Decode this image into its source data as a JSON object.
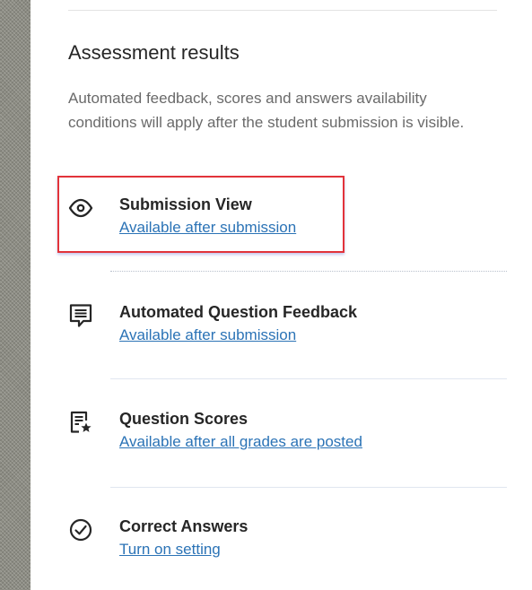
{
  "section": {
    "title": "Assessment results",
    "description": "Automated feedback, scores and answers availability conditions will apply after the student submission is visible."
  },
  "rows": [
    {
      "label": "Submission View",
      "link": "Available after submission",
      "icon": "eye-icon",
      "highlighted": true
    },
    {
      "label": "Automated Question Feedback",
      "link": "Available after submission",
      "icon": "feedback-icon"
    },
    {
      "label": "Question Scores",
      "link": "Available after all grades are posted",
      "icon": "scores-icon"
    },
    {
      "label": "Correct Answers",
      "link": "Turn on setting",
      "icon": "check-circle-icon"
    }
  ],
  "colors": {
    "link": "#2b73b6",
    "highlight_border": "#e2333a",
    "text": "#262626",
    "muted_text": "#6a6a6a"
  }
}
